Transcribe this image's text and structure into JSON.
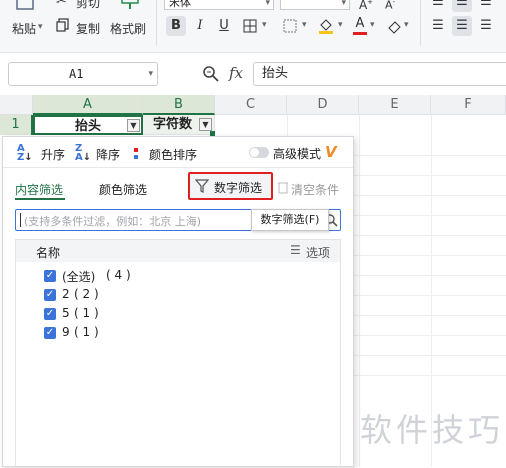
{
  "ribbon": {
    "cut_label": "剪切",
    "paste_label": "粘贴",
    "copy_label": "复制",
    "format_painter_label": "格式刷",
    "font_name": "宋体"
  },
  "formula_bar": {
    "cell_ref": "A1",
    "fx_label": "fx",
    "value": "抬头"
  },
  "grid": {
    "columns": [
      "A",
      "B",
      "C",
      "D",
      "E",
      "F"
    ],
    "row_number": "1",
    "cell_a1": "抬头",
    "cell_b1": "字符数"
  },
  "filter_panel": {
    "sort_asc": "升序",
    "sort_desc": "降序",
    "color_sort": "颜色排序",
    "advanced_mode": "高级模式",
    "tab_content": "内容筛选",
    "tab_color": "颜色筛选",
    "number_filter": "数字筛选",
    "clear_conditions": "清空条件",
    "search_placeholder": "(支持多条件过滤，例如：北京  上海)",
    "tooltip": "数字筛选(F)",
    "list_header": "名称",
    "options_label": "选项",
    "items": [
      {
        "label": "(全选)",
        "count": "( 4 )"
      },
      {
        "label": "2",
        "count": "( 2 )"
      },
      {
        "label": "5",
        "count": "( 1 )"
      },
      {
        "label": "9",
        "count": "( 1 )"
      }
    ]
  },
  "watermark": "软件技巧",
  "colors": {
    "accent_green": "#217346",
    "checkbox_blue": "#3b73d9",
    "highlight_red": "#e02020",
    "advanced_icon_orange": "#f08a24"
  }
}
